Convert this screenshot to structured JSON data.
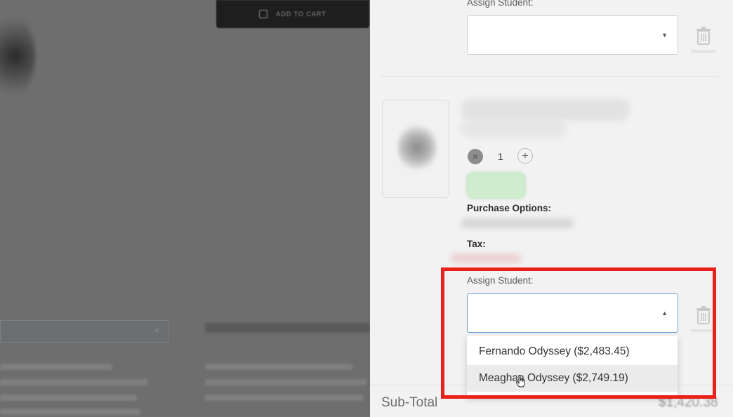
{
  "background_page": {
    "add_to_cart_label": "ADD TO CART"
  },
  "drawer": {
    "item1": {
      "assign_student_label": "Assign Student:"
    },
    "item2": {
      "quantity": "1",
      "purchase_options_label": "Purchase Options:",
      "tax_label": "Tax:",
      "assign_student_label": "Assign Student:",
      "dropdown_options": [
        "Fernando Odyssey ($2,483.45)",
        "Meaghan Odyssey ($2,749.19)"
      ]
    },
    "subtotal_label": "Sub-Total",
    "subtotal_value": "$1,420.38"
  },
  "icons": {
    "caret_down": "caret-down-icon",
    "caret_up": "caret-up-icon",
    "trash": "trash-icon",
    "cursor": "hand-cursor-icon"
  },
  "colors": {
    "highlight": "#e8221a",
    "focus_border": "#6a9ed6",
    "overlay": "#6e6e6e"
  }
}
